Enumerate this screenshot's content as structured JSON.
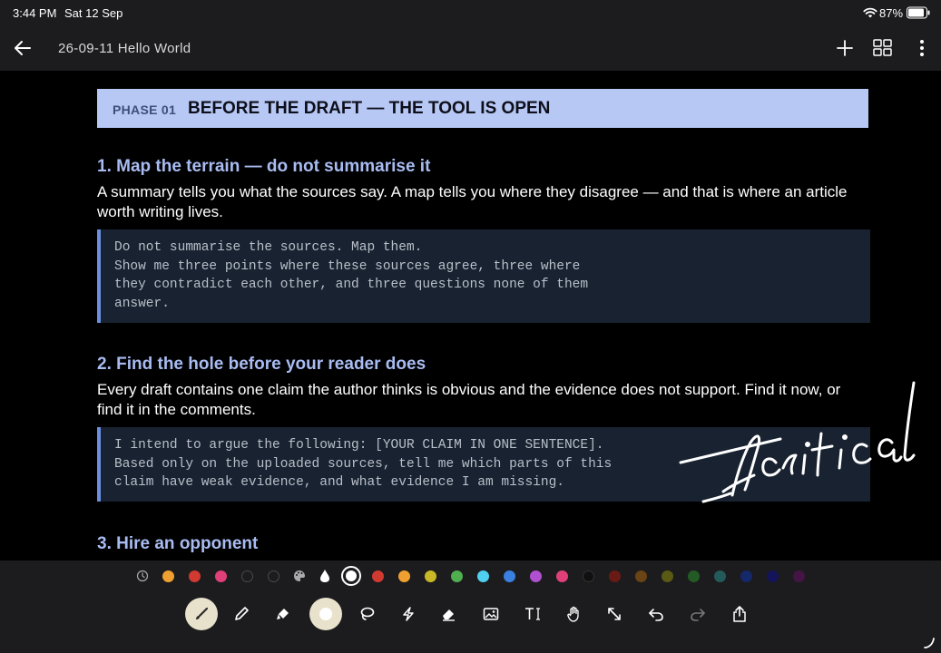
{
  "status_bar": {
    "time": "3:44 PM",
    "date": "Sat 12 Sep",
    "battery": "87%"
  },
  "nav": {
    "title": "26-09-11 Hello World",
    "back_icon": "arrow-left-icon",
    "add_icon": "plus-icon",
    "grid_icon": "grid-view-icon",
    "more_icon": "more-vertical-icon"
  },
  "document": {
    "phase_number": "PHASE 01",
    "phase_title": "BEFORE THE DRAFT — THE TOOL IS OPEN",
    "sections": [
      {
        "heading": "1.  Map the terrain — do not summarise it",
        "body": "A summary tells you what the sources say. A map tells you where they disagree — and that is where an article worth writing lives.",
        "code": "Do not summarise the sources. Map them.\nShow me three points where these sources agree, three where\nthey contradict each other, and three questions none of them\nanswer."
      },
      {
        "heading": "2.  Find the hole before your reader does",
        "body": "Every draft contains one claim the author thinks is obvious and the evidence does not support. Find it now, or find it in the comments.",
        "code": "I intend to argue the following: [YOUR CLAIM IN ONE SENTENCE].\nBased only on the uploaded sources, tell me which parts of this\nclaim have weak evidence, and what evidence I am missing."
      },
      {
        "heading": "3.  Hire an opponent"
      }
    ],
    "annotation": "critical"
  },
  "toolbar": {
    "colors": {
      "banner_bg": "#b8c8f5",
      "heading": "#a9bcf2",
      "code_bg": "#182230",
      "code_border": "#6b8fdf"
    },
    "palette_left": [
      "#f0a030",
      "#d03a30",
      "#e0407a",
      "empty",
      "empty"
    ],
    "palette_right": [
      "#d03a30",
      "#f0a030",
      "#c8b828",
      "#50b050",
      "#50d0f0",
      "#3a80e0",
      "#b050d0",
      "#e0407a",
      "#101010",
      "#6a1a14",
      "#6a4414",
      "#5a5a14",
      "#245a24",
      "#245a5a",
      "#14286a",
      "#14145a",
      "#441444"
    ],
    "tools": [
      "brush-icon",
      "pencil-icon",
      "marker-icon",
      "shape-icon",
      "lasso-icon",
      "flash-icon",
      "eraser-icon",
      "image-icon",
      "text-icon",
      "hand-icon",
      "resize-icon",
      "undo-icon",
      "redo-icon",
      "share-icon"
    ]
  }
}
